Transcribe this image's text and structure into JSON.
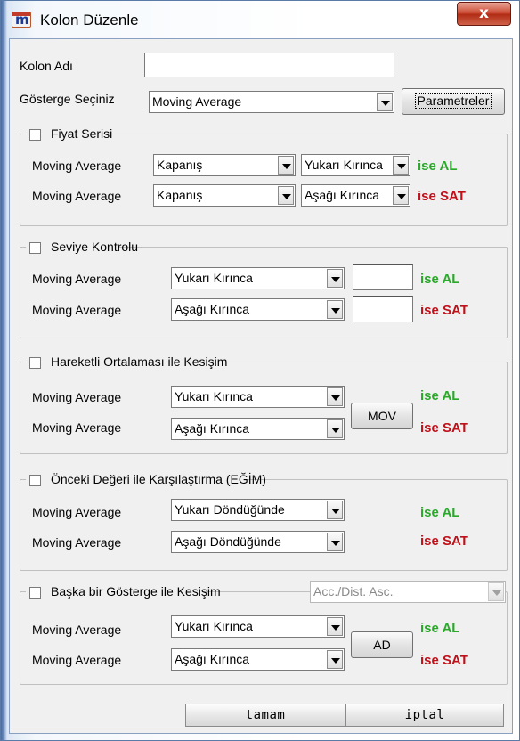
{
  "window": {
    "title": "Kolon Düzenle",
    "close_glyph": "x"
  },
  "kolon_adi": {
    "label": "Kolon Adı",
    "value": ""
  },
  "gosterge": {
    "label": "Gösterge Seçiniz",
    "value": "Moving Average",
    "param_button": "Parametreler"
  },
  "fiyat_serisi": {
    "title": "Fiyat Serisi",
    "rows": [
      {
        "label": "Moving Average",
        "combo1": "Kapanış",
        "combo2": "Yukarı Kırınca",
        "result": "ise AL"
      },
      {
        "label": "Moving Average",
        "combo1": "Kapanış",
        "combo2": "Aşağı Kırınca",
        "result": "ise SAT"
      }
    ]
  },
  "seviye_kontrolu": {
    "title": "Seviye Kontrolu",
    "rows": [
      {
        "label": "Moving Average",
        "combo": "Yukarı Kırınca",
        "value": "",
        "result": "ise AL"
      },
      {
        "label": "Moving Average",
        "combo": "Aşağı Kırınca",
        "value": "",
        "result": "ise SAT"
      }
    ]
  },
  "hareketli": {
    "title": "Hareketli Ortalaması ile Kesişim",
    "button": "MOV",
    "rows": [
      {
        "label": "Moving Average",
        "combo": "Yukarı Kırınca",
        "result": "ise AL"
      },
      {
        "label": "Moving Average",
        "combo": "Aşağı Kırınca",
        "result": "ise SAT"
      }
    ]
  },
  "onceki": {
    "title": "Önceki Değeri ile Karşılaştırma (EĞİM)",
    "rows": [
      {
        "label": "Moving Average",
        "combo": "Yukarı Döndüğünde",
        "result": "ise AL"
      },
      {
        "label": "Moving Average",
        "combo": "Aşağı Döndüğünde",
        "result": "ise SAT"
      }
    ]
  },
  "baska": {
    "title": "Başka bir Gösterge ile Kesişim",
    "indicator": "Acc./Dist. Asc.",
    "button": "AD",
    "rows": [
      {
        "label": "Moving Average",
        "combo": "Yukarı Kırınca",
        "result": "ise AL"
      },
      {
        "label": "Moving Average",
        "combo": "Aşağı Kırınca",
        "result": "ise SAT"
      }
    ]
  },
  "footer": {
    "ok": "tamam",
    "cancel": "iptal"
  },
  "colors": {
    "buy": "#2aa82a",
    "sell": "#c0101a",
    "close": "#c8452e"
  },
  "icons": [
    "app-logo-icon",
    "close-icon",
    "checkbox-icon",
    "dropdown-arrow-icon"
  ]
}
